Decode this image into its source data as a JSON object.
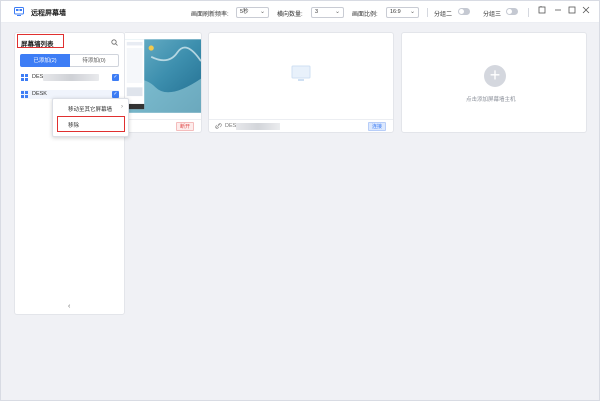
{
  "app": {
    "title": "远程屏幕墙"
  },
  "toolbar": {
    "refresh_label": "画面刷新频率:",
    "refresh_value": "5秒",
    "cols_label": "横向数量:",
    "cols_value": "3",
    "ratio_label": "画面比例:",
    "ratio_value": "16:9",
    "split2_label": "分组二",
    "split3_label": "分组三"
  },
  "panel": {
    "title": "屏幕墙列表",
    "tabs": [
      {
        "label": "已添加(2)"
      },
      {
        "label": "待添加(0)"
      }
    ],
    "items": [
      {
        "name": "DES"
      },
      {
        "name": "DESK"
      }
    ],
    "collapse_icon": "chevron-left-icon"
  },
  "context_menu": {
    "move_label": "移动至其它屏幕墙",
    "remove_label": "移除"
  },
  "cards": [
    {
      "button": "断开"
    },
    {
      "device": "DES",
      "button": "连接"
    },
    {
      "add_text": "点击添加屏幕墙主机"
    }
  ]
}
